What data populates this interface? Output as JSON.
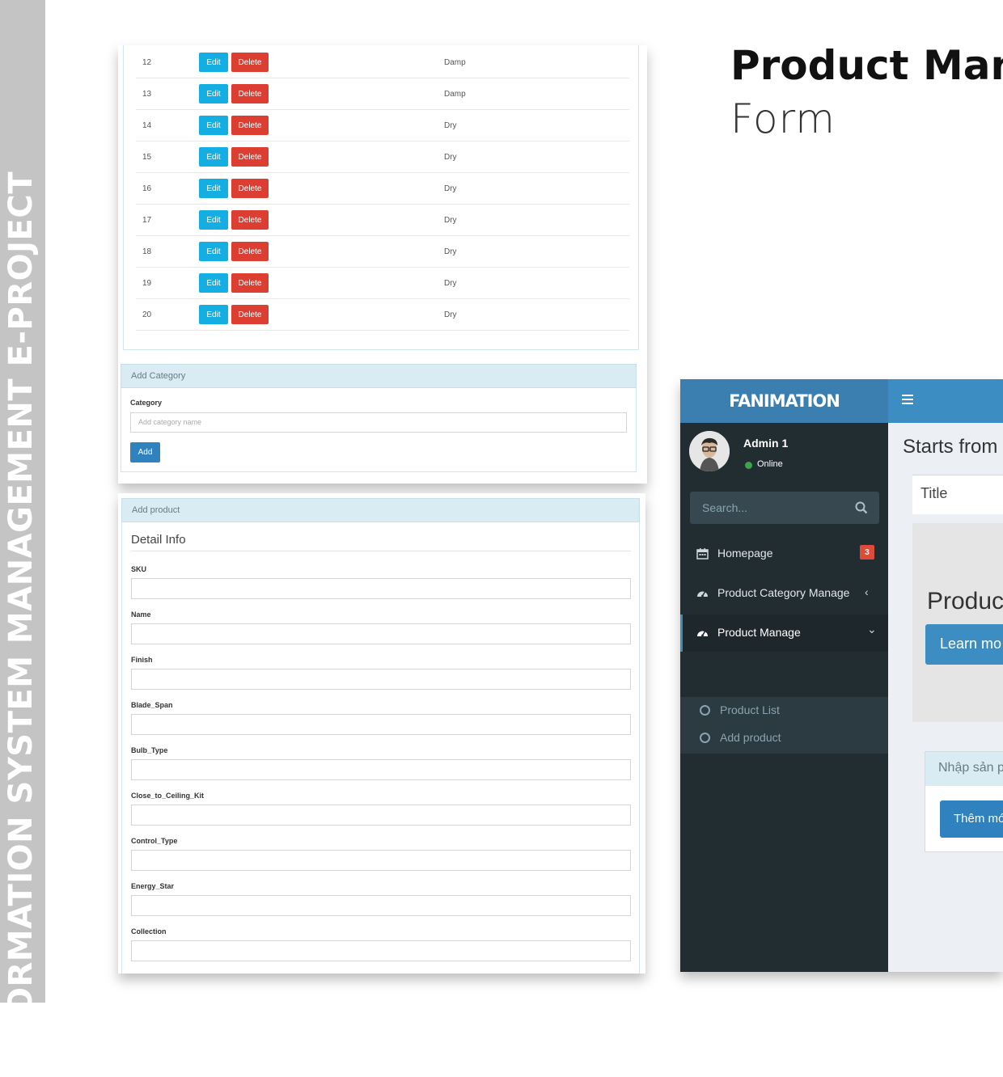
{
  "banner": {
    "side_title": "INFORMATION SYSTEM MANAGEMENT E-PROJECT",
    "heading": "Product Man",
    "subheading": "Form"
  },
  "category_table": {
    "edit_label": "Edit",
    "delete_label": "Delete",
    "rows": [
      {
        "id": "12",
        "type": "Damp"
      },
      {
        "id": "13",
        "type": "Damp"
      },
      {
        "id": "14",
        "type": "Dry"
      },
      {
        "id": "15",
        "type": "Dry"
      },
      {
        "id": "16",
        "type": "Dry"
      },
      {
        "id": "17",
        "type": "Dry"
      },
      {
        "id": "18",
        "type": "Dry"
      },
      {
        "id": "19",
        "type": "Dry"
      },
      {
        "id": "20",
        "type": "Dry"
      }
    ]
  },
  "add_category": {
    "title": "Add Category",
    "field_label": "Category",
    "placeholder": "Add category name",
    "button": "Add"
  },
  "add_product": {
    "title": "Add product",
    "section": "Detail Info",
    "fields": [
      "SKU",
      "Name",
      "Finish",
      "Blade_Span",
      "Bulb_Type",
      "Close_to_Ceiling_Kit",
      "Control_Type",
      "Energy_Star",
      "Collection"
    ]
  },
  "admin_panel": {
    "logo": "FANIMATION",
    "user_name": "Admin 1",
    "status": "Online",
    "search_placeholder": "Search...",
    "menu": [
      {
        "label": "Homepage",
        "icon": "calendar-icon",
        "badge": "3"
      },
      {
        "label": "Product Category Manage",
        "icon": "dashboard-icon",
        "chevron": "‹"
      },
      {
        "label": "Product Manage",
        "icon": "dashboard-icon",
        "chevron": "⌄"
      }
    ],
    "submenu": [
      "Product List",
      "Add product"
    ],
    "content_title": "Starts from",
    "box_title": "Title",
    "jumbotron_text": "Produc",
    "jumbotron_button": "Learn mo",
    "vn_panel_title": "Nhập sản p",
    "vn_button": "Thêm mớ"
  },
  "colors": {
    "side_strip": "#c4c4c4",
    "edit_button": "#14aee3",
    "delete_button": "#dd3e32",
    "panel_header": "#d9ecf4",
    "primary": "#2f82be",
    "sidebar": "#222d32",
    "header": "#3c8dc2"
  }
}
